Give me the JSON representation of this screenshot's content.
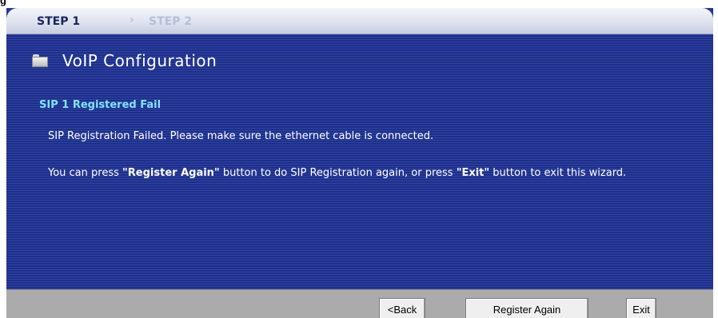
{
  "corner_glyph": "g",
  "wizard": {
    "steps": [
      {
        "label": "STEP 1",
        "active": true
      },
      {
        "label": "STEP 2",
        "active": false
      }
    ],
    "step_separator": "›"
  },
  "page": {
    "title": "VoIP Configuration",
    "title_icon": "folder-icon",
    "subheading": "SIP 1 Registered Fail",
    "message_line1": "SIP Registration Failed. Please make sure the ethernet cable is connected.",
    "message_line2": {
      "part1": "You can press ",
      "register_quoted": "\"Register Again\"",
      "part2": " button to do SIP Registration again, or press ",
      "exit_quoted": "\"Exit\"",
      "part3": " button to exit this wizard."
    }
  },
  "buttons": {
    "back_label": "<Back",
    "register_label": "Register Again",
    "exit_label": "Exit"
  },
  "colors": {
    "panel_bg": "#1c2f8e",
    "subheading": "#7fe3ff",
    "footer_bg": "#ababab",
    "active_step": "#1a2660",
    "inactive_step": "#b7bfd6"
  }
}
